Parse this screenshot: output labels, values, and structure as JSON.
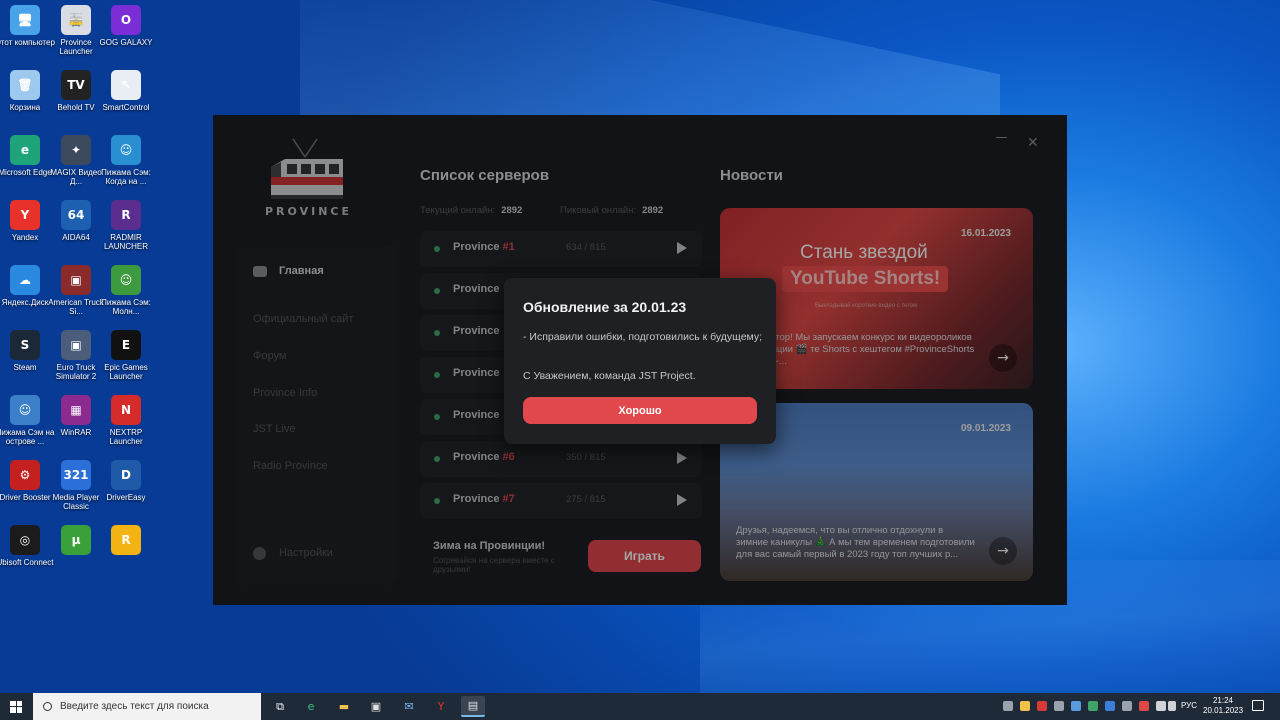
{
  "desktop": {
    "icons": [
      {
        "label": "Этот компьютер",
        "glyph": "🖥",
        "color": "#4aa3e8"
      },
      {
        "label": "Province Launcher",
        "glyph": "🚋",
        "color": "#d9dce3"
      },
      {
        "label": "GOG GALAXY",
        "glyph": "O",
        "color": "#7b2ed6"
      },
      {
        "label": "Корзина",
        "glyph": "🗑",
        "color": "#9ec9ef"
      },
      {
        "label": "Behold TV",
        "glyph": "TV",
        "color": "#222222"
      },
      {
        "label": "SmartControl",
        "glyph": "↖",
        "color": "#e9eef5"
      },
      {
        "label": "Microsoft Edge",
        "glyph": "e",
        "color": "#1fa37a"
      },
      {
        "label": "MAGIX Видео Д...",
        "glyph": "✦",
        "color": "#3d4a5e"
      },
      {
        "label": "Пижама Сэм: Когда на ...",
        "glyph": "☺",
        "color": "#2a8fd1"
      },
      {
        "label": "Yandex",
        "glyph": "Y",
        "color": "#e7312a"
      },
      {
        "label": "AIDA64",
        "glyph": "64",
        "color": "#1d5fb0"
      },
      {
        "label": "RADMIR LAUNCHER",
        "glyph": "R",
        "color": "#5a2d8f"
      },
      {
        "label": "Яндекс.Диск",
        "glyph": "☁",
        "color": "#2b89e0"
      },
      {
        "label": "American Truck Si...",
        "glyph": "▣",
        "color": "#8a2b2b"
      },
      {
        "label": "Пижама Сэм: Молн...",
        "glyph": "☺",
        "color": "#3e9a3e"
      },
      {
        "label": "Steam",
        "glyph": "S",
        "color": "#1b2838"
      },
      {
        "label": "Euro Truck Simulator 2",
        "glyph": "▣",
        "color": "#4b5d7a"
      },
      {
        "label": "Epic Games Launcher",
        "glyph": "E",
        "color": "#111111"
      },
      {
        "label": "Пижама Сэм на острове ...",
        "glyph": "☺",
        "color": "#3a7fc8"
      },
      {
        "label": "WinRAR",
        "glyph": "▦",
        "color": "#8b2a8f"
      },
      {
        "label": "NEXTRP Launcher",
        "glyph": "N",
        "color": "#d62b2b"
      },
      {
        "label": "Driver Booster",
        "glyph": "⚙",
        "color": "#c42020"
      },
      {
        "label": "Media Player Classic",
        "glyph": "321",
        "color": "#2b6fd8"
      },
      {
        "label": "DriverEasy",
        "glyph": "D",
        "color": "#1e5aa8"
      },
      {
        "label": "Ubisoft Connect",
        "glyph": "◎",
        "color": "#1b1b1b"
      },
      {
        "label": "",
        "glyph": "μ",
        "color": "#3aa03a"
      },
      {
        "label": "",
        "glyph": "R",
        "color": "#f2b313"
      }
    ]
  },
  "launcher": {
    "logo_text": "PROVINCE",
    "nav": {
      "home": "Главная",
      "official_site": "Официальный сайт",
      "forum": "Форум",
      "province_info": "Province Info",
      "jst_live": "JST Live",
      "radio": "Radio Province",
      "settings": "Настройки"
    },
    "servers": {
      "title": "Список серверов",
      "current_online_label": "Текущий онлайн:",
      "current_online": "2892",
      "peak_online_label": "Пиковый онлайн:",
      "peak_online": "2892",
      "rows": [
        {
          "name": "Province",
          "num": "#1",
          "count": "634 / 815"
        },
        {
          "name": "Province",
          "num": "",
          "count": ""
        },
        {
          "name": "Province",
          "num": "",
          "count": ""
        },
        {
          "name": "Province",
          "num": "",
          "count": ""
        },
        {
          "name": "Province",
          "num": "",
          "count": ""
        },
        {
          "name": "Province",
          "num": "#6",
          "count": "350 / 815"
        },
        {
          "name": "Province",
          "num": "#7",
          "count": "275 / 815"
        }
      ],
      "promo_title": "Зима на Провинции!",
      "promo_sub": "Согревайся на сервера вместе с друзьями!",
      "play_label": "Играть"
    },
    "news": {
      "title": "Новости",
      "cards": [
        {
          "date": "16.01.2023",
          "banner_line1": "Стань звездой",
          "banner_line2": "YouTube Shorts!",
          "banner_small": "Выкладывай короткие видео с тегом",
          "text": "мера, мотор! Мы запускаем конкурс ки видеороликов о Провинции 🎬 те Shorts с хештегом #ProvinceShorts на uTube-..."
        },
        {
          "date": "09.01.2023",
          "text": "Друзья, надеемся, что вы отлично отдохнули в зимние каникулы 🎄 А мы тем временем подготовили для вас самый первый в 2023 году топ лучших р..."
        }
      ]
    }
  },
  "modal": {
    "title": "Обновление за 20.01.23",
    "body": "- Исправили ошибки, подготовились к будущему;",
    "signature": "С Уважением, команда JST Project.",
    "button": "Хорошо"
  },
  "taskbar": {
    "search_placeholder": "Введите здесь текст для поиска",
    "lang": "РУС",
    "time": "21:24",
    "date": "20.01.2023"
  },
  "colors": {
    "accent_red": "#e0484c",
    "online_green": "#3fa56a",
    "window_bg": "#1d1e22"
  }
}
